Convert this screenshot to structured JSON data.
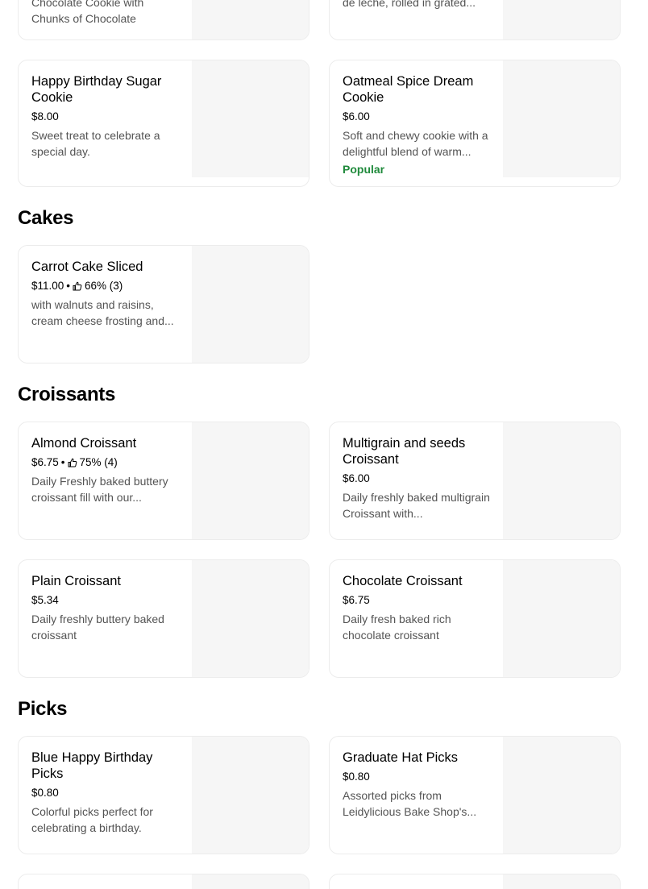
{
  "sections": {
    "cookies_tail": {
      "items": [
        {
          "name": "",
          "meta": "",
          "desc": "Chocolate Cookie with Chunks of Chocolate"
        },
        {
          "name": "",
          "meta": "",
          "desc": "de leche, rolled in grated..."
        },
        {
          "name": "Happy Birthday Sugar Cookie",
          "price": "$8.00",
          "desc": "Sweet treat to celebrate a special day."
        },
        {
          "name": "Oatmeal Spice Dream Cookie",
          "price": "$6.00",
          "desc": "Soft and chewy cookie with a delightful blend of warm...",
          "badge": "Popular"
        }
      ]
    },
    "cakes": {
      "title": "Cakes",
      "items": [
        {
          "name": "Carrot Cake Sliced",
          "price": "$11.00",
          "rating": "66% (3)",
          "desc": "with walnuts and raisins, cream cheese frosting and..."
        }
      ]
    },
    "croissants": {
      "title": "Croissants",
      "items": [
        {
          "name": "Almond Croissant",
          "price": "$6.75",
          "rating": "75% (4)",
          "desc": "Daily Freshly baked buttery croissant fill with our..."
        },
        {
          "name": "Multigrain and seeds Croissant",
          "price": "$6.00",
          "desc": "Daily freshly baked multigrain Croissant with..."
        },
        {
          "name": "Plain Croissant",
          "price": "$5.34",
          "desc": "Daily freshly buttery baked croissant"
        },
        {
          "name": "Chocolate Croissant",
          "price": "$6.75",
          "desc": "Daily fresh baked rich chocolate croissant"
        }
      ]
    },
    "picks": {
      "title": "Picks",
      "items": [
        {
          "name": "Blue Happy Birthday Picks",
          "price": "$0.80",
          "desc": "Colorful picks perfect for celebrating a birthday."
        },
        {
          "name": "Graduate Hat Picks",
          "price": "$0.80",
          "desc": "Assorted picks from Leidylicious Bake Shop's..."
        }
      ]
    }
  },
  "colors": {
    "badge": "#1f8a3b",
    "desc": "#545454",
    "thumb": "#f6f6f6"
  },
  "icons": {
    "rating": "thumbs-up-icon"
  },
  "separator": "•"
}
